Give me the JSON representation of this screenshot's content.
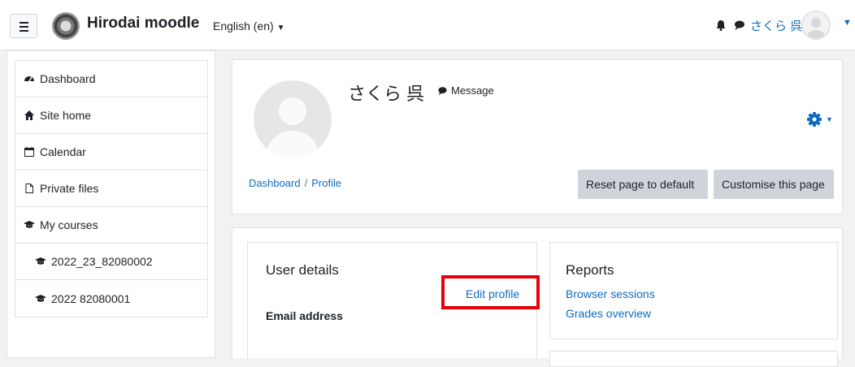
{
  "navbar": {
    "brand": "Hirodai moodle",
    "language": "English (en)",
    "username": "さくら 呉"
  },
  "sidebar": {
    "items": [
      {
        "label": "Dashboard",
        "icon": "dashboard-icon"
      },
      {
        "label": "Site home",
        "icon": "home-icon"
      },
      {
        "label": "Calendar",
        "icon": "calendar-icon"
      },
      {
        "label": "Private files",
        "icon": "file-icon"
      },
      {
        "label": "My courses",
        "icon": "graduation-cap-icon"
      },
      {
        "label": "2022_23_82080002",
        "icon": "graduation-cap-icon"
      },
      {
        "label": "2022 82080001",
        "icon": "graduation-cap-icon"
      }
    ]
  },
  "header": {
    "profile_name": "さくら 呉",
    "message_label": "Message",
    "breadcrumb": [
      "Dashboard",
      "Profile"
    ],
    "breadcrumb_sep": "/",
    "reset_button": "Reset page to default",
    "customise_button": "Customise this page"
  },
  "user_details": {
    "title": "User details",
    "edit_profile": "Edit profile",
    "email_label": "Email address"
  },
  "reports": {
    "title": "Reports",
    "links": [
      "Browser sessions",
      "Grades overview"
    ]
  },
  "colors": {
    "link": "#0f6cbf",
    "highlight": "#e8000b",
    "button": "#ced4da"
  }
}
